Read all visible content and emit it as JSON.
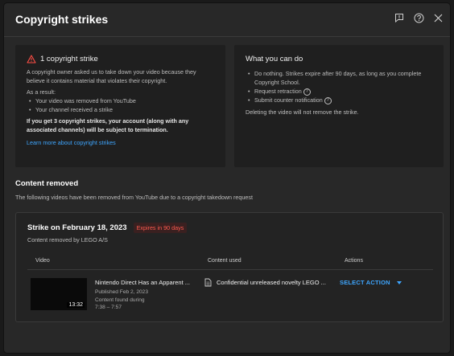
{
  "dialog": {
    "title": "Copyright strikes"
  },
  "header_icons": [
    "feedback-icon",
    "help-icon",
    "close-icon"
  ],
  "strike_summary": {
    "heading": "1 copyright strike",
    "description": "A copyright owner asked us to take down your video because they believe it contains material that violates their copyright.",
    "result_label": "As a result:",
    "results": [
      "Your video was removed from YouTube",
      "Your channel received a strike"
    ],
    "warning": "If you get 3 copyright strikes, your account (along with any associated channels) will be subject to termination.",
    "learn_more_link": "Learn more about copyright strikes"
  },
  "what_you_can_do": {
    "heading": "What you can do",
    "options": [
      "Do nothing. Strikes expire after 90 days, as long as you complete Copyright School.",
      "Request retraction",
      "Submit counter notification"
    ],
    "note": "Deleting the video will not remove the strike."
  },
  "content_removed": {
    "title": "Content removed",
    "subtitle": "The following videos have been removed from YouTube due to a copyright takedown request"
  },
  "strike": {
    "title": "Strike on February 18, 2023",
    "expires": "Expires in 90 days",
    "removed_by": "Content removed by LEGO A/S",
    "columns": {
      "video": "Video",
      "content_used": "Content used",
      "actions": "Actions"
    },
    "video": {
      "title": "Nintendo Direct Has an Apparent ...",
      "duration": "13:32",
      "published": "Published Feb 2, 2023",
      "found_label": "Content found during",
      "found_range": "7:38 – 7:57"
    },
    "content_used": "Confidential unreleased novelty LEGO ...",
    "action_label": "SELECT ACTION"
  },
  "colors": {
    "accent": "#3ea6ff",
    "warning": "#ff5a4e",
    "dialog_bg": "#282828",
    "card_bg": "#1f1f1f"
  }
}
